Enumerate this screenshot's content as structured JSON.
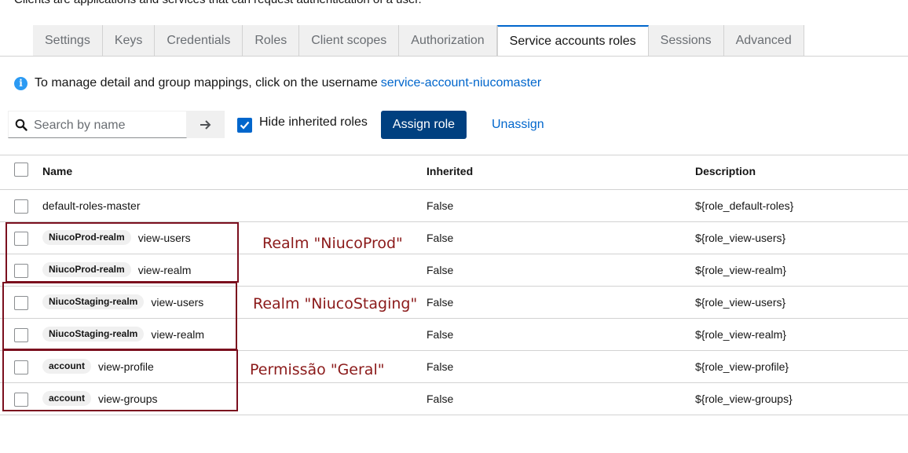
{
  "header": {
    "description": "Clients are applications and services that can request authentication of a user."
  },
  "tabs": [
    {
      "label": "Settings"
    },
    {
      "label": "Keys"
    },
    {
      "label": "Credentials"
    },
    {
      "label": "Roles"
    },
    {
      "label": "Client scopes"
    },
    {
      "label": "Authorization"
    },
    {
      "label": "Service accounts roles",
      "active": true
    },
    {
      "label": "Sessions"
    },
    {
      "label": "Advanced"
    }
  ],
  "info": {
    "icon": "info-icon",
    "text": "To manage detail and group mappings, click on the username",
    "link": "service-account-niucomaster"
  },
  "toolbar": {
    "search_placeholder": "Search by name",
    "hide_inherited_label": "Hide inherited roles",
    "hide_inherited_checked": true,
    "assign_label": "Assign role",
    "unassign_label": "Unassign"
  },
  "table": {
    "columns": {
      "name": "Name",
      "inherited": "Inherited",
      "description": "Description"
    },
    "rows": [
      {
        "badge": "",
        "name": "default-roles-master",
        "inherited": "False",
        "description": "${role_default-roles}"
      },
      {
        "badge": "NiucoProd-realm",
        "name": "view-users",
        "inherited": "False",
        "description": "${role_view-users}"
      },
      {
        "badge": "NiucoProd-realm",
        "name": "view-realm",
        "inherited": "False",
        "description": "${role_view-realm}"
      },
      {
        "badge": "NiucoStaging-realm",
        "name": "view-users",
        "inherited": "False",
        "description": "${role_view-users}"
      },
      {
        "badge": "NiucoStaging-realm",
        "name": "view-realm",
        "inherited": "False",
        "description": "${role_view-realm}"
      },
      {
        "badge": "account",
        "name": "view-profile",
        "inherited": "False",
        "description": "${role_view-profile}"
      },
      {
        "badge": "account",
        "name": "view-groups",
        "inherited": "False",
        "description": "${role_view-groups}"
      }
    ]
  },
  "annotations": {
    "prod": "Realm \"NiucoProd\"",
    "staging": "Realm \"NiucoStaging\"",
    "general": "Permissão \"Geral\"",
    "color": "#8b1a1a"
  },
  "colors": {
    "accent": "#0066cc",
    "primary_button": "#004080",
    "info": "#2b9af3"
  }
}
